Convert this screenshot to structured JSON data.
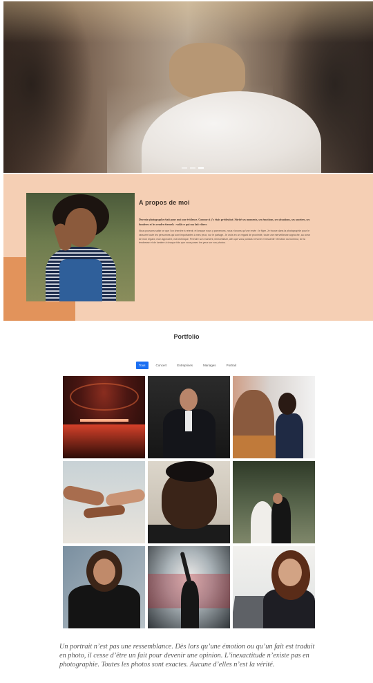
{
  "hero": {
    "slides_count": 3,
    "active_slide": 2
  },
  "about": {
    "title": "A propos de moi",
    "lead": "Devenir photographe était pour moi une évidence. Comme si j’y étais prédestiné. Sûrité ses moments, ses émotions, ses situations, ses sourires, ses lumières et les rendre éternels : voilà ce qui ma fait vibrer.",
    "body": "Nous pouvons saisir ce que l’on cherche à retenir, et lorsque nous y parvenons, nous n’avons qu’une envie : le figer. Je trouve dans la photographie pour le rassurer toute les personnes qui sont importantes à mes yeux, sur le partage. Je crois en un regard de proximité, toute une merveilleuse approche, au cœur de mon regard, mon approche, ma technique. Prendre son moment, immortaliser, afin que vous puissiez revivre et ressentir l’émotion du bonheur, de la tendresse et de lumière à chaque fois que vous posez les yeux sur vos photos.",
    "colors": {
      "background": "#f5cfb4",
      "accent": "#e2935b"
    }
  },
  "portfolio": {
    "title": "Portfolio",
    "filters": [
      {
        "label": "Tous",
        "active": true
      },
      {
        "label": "Concert",
        "active": false
      },
      {
        "label": "Entreprises",
        "active": false
      },
      {
        "label": "Mariages",
        "active": false
      },
      {
        "label": "Portrait",
        "active": false
      }
    ],
    "active_color": "#1b6ff2",
    "tiles": [
      "concert-stage",
      "businessman-portrait",
      "office-meeting",
      "holding-hands",
      "man-portrait",
      "wedding-couple",
      "woman-glasses-portrait",
      "concert-crowd-smoke",
      "woman-laughing-laptop"
    ]
  },
  "quote": {
    "text": "Un portrait n’est pas une ressemblance. Dès lors qu’une émotion ou qu’un fait est traduit en photo, il cesse d’être un fait pour devenir une opinion. L’inexactitude n’existe pas en photographie. Toutes les photos sont exactes. Aucune d’elles n’est la vérité."
  }
}
